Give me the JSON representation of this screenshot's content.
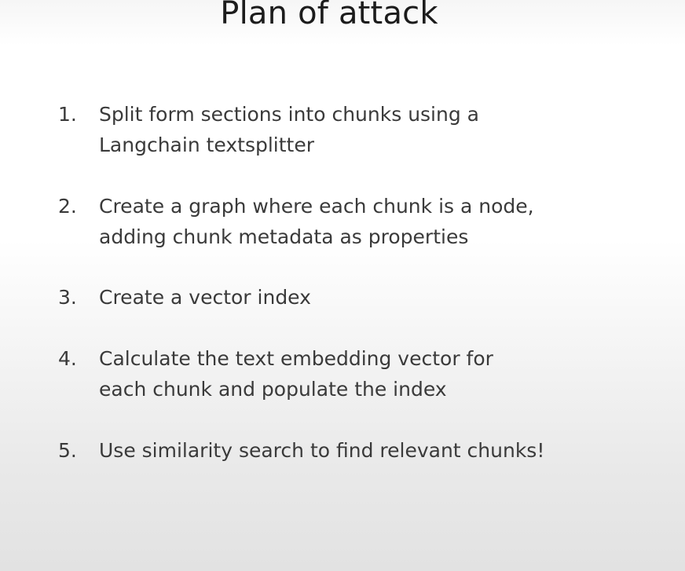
{
  "slide": {
    "title": "Plan of attack",
    "items": [
      {
        "number": "1.",
        "lines": [
          "Split form sections into chunks using a",
          "Langchain textsplitter"
        ]
      },
      {
        "number": "2.",
        "lines": [
          "Create a graph where each chunk is a node,",
          "adding chunk metadata as properties"
        ]
      },
      {
        "number": "3.",
        "lines": [
          "Create a vector index"
        ]
      },
      {
        "number": "4.",
        "lines": [
          "Calculate the text embedding vector for",
          "each chunk and populate the index"
        ]
      },
      {
        "number": "5.",
        "lines": [
          "Use similarity search to find relevant chunks!"
        ]
      }
    ]
  }
}
